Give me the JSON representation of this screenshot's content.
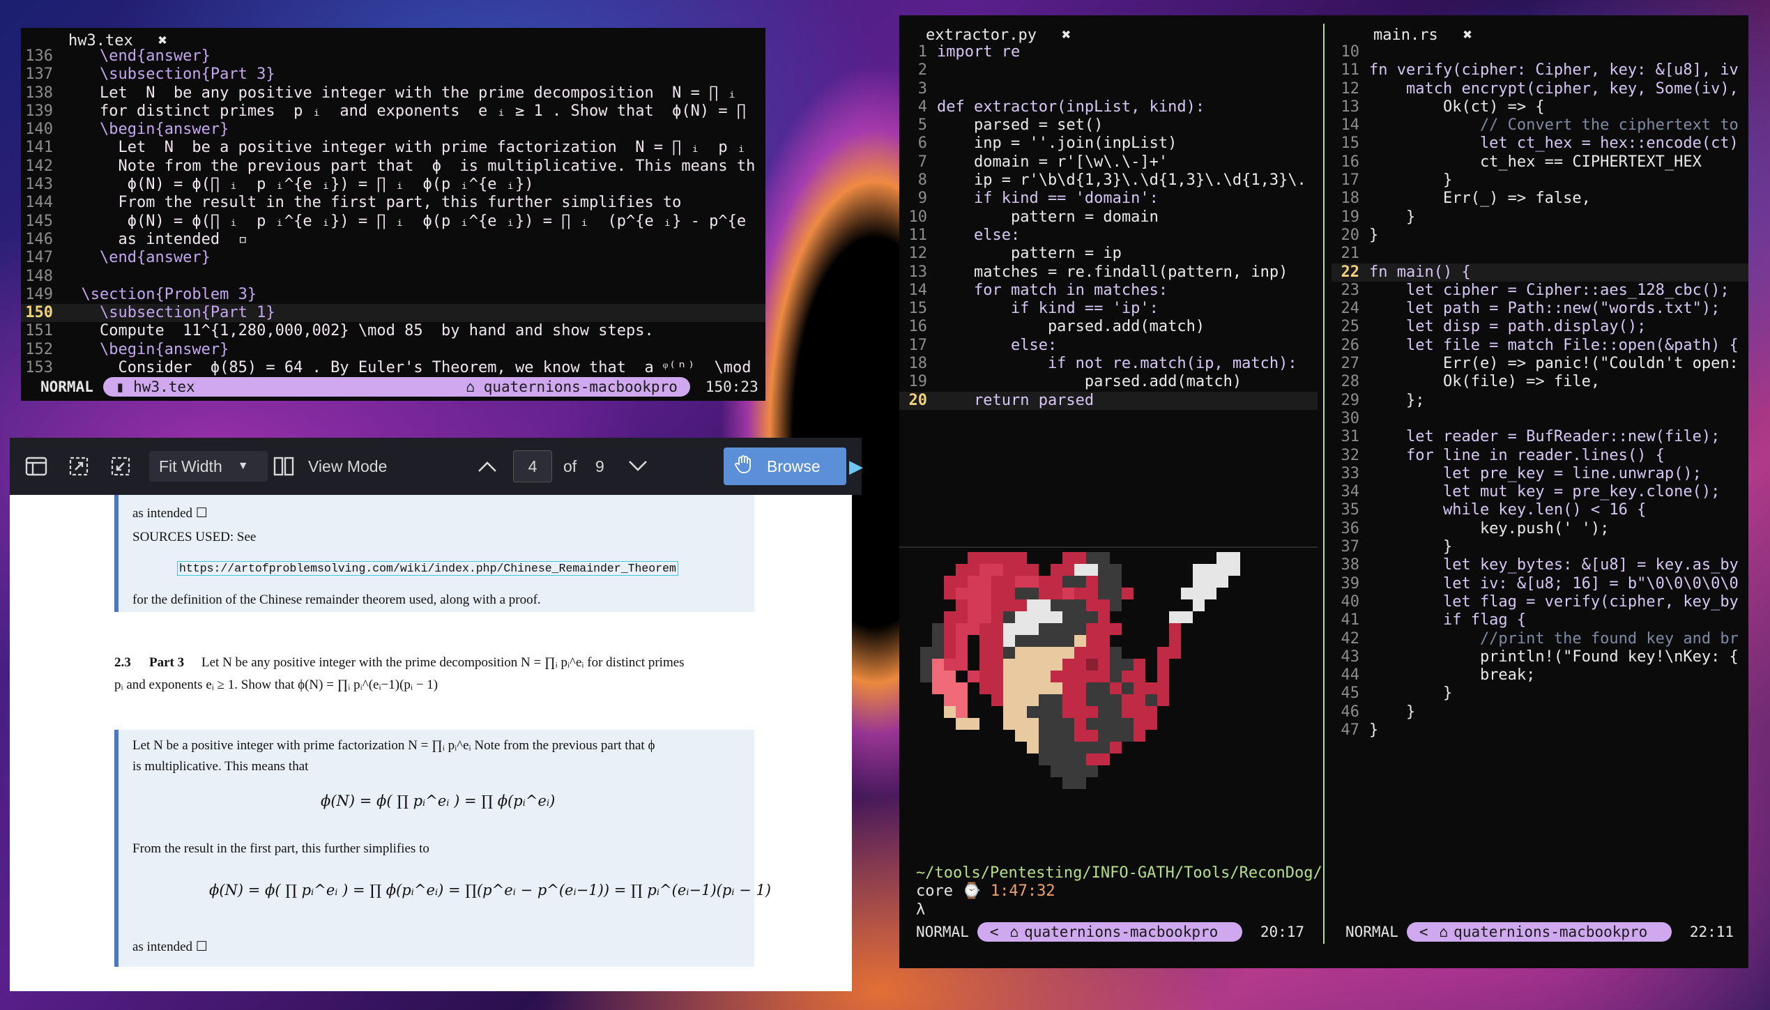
{
  "tex_window": {
    "tab": "hw3.tex",
    "close": "✖",
    "lines": [
      {
        "n": "136",
        "t": "    \\end{answer}"
      },
      {
        "n": "137",
        "t": "    \\subsection{Part 3}"
      },
      {
        "n": "138",
        "t": "    Let  N  be any positive integer with the prime decomposition  N = ∏ ᵢ"
      },
      {
        "n": "139",
        "t": "    for distinct primes  p ᵢ  and exponents  e ᵢ ≥ 1 . Show that  ϕ(N) = ∏"
      },
      {
        "n": "140",
        "t": "    \\begin{answer}"
      },
      {
        "n": "141",
        "t": "      Let  N  be a positive integer with prime factorization  N = ∏ ᵢ  p ᵢ"
      },
      {
        "n": "142",
        "t": "      Note from the previous part that  ϕ  is multiplicative. This means th"
      },
      {
        "n": "143",
        "t": "       ϕ(N) = ϕ(∏ ᵢ  p ᵢ^{e ᵢ}) = ∏ ᵢ  ϕ(p ᵢ^{e ᵢ})"
      },
      {
        "n": "144",
        "t": "      From the result in the first part, this further simplifies to"
      },
      {
        "n": "145",
        "t": "       ϕ(N) = ϕ(∏ ᵢ  p ᵢ^{e ᵢ}) = ∏ ᵢ  ϕ(p ᵢ^{e ᵢ}) = ∏ ᵢ  (p^{e ᵢ} - p^{e"
      },
      {
        "n": "146",
        "t": "      as intended  ▫"
      },
      {
        "n": "147",
        "t": "    \\end{answer}"
      },
      {
        "n": "148",
        "t": ""
      },
      {
        "n": "149",
        "t": "  \\section{Problem 3}"
      },
      {
        "n": "150",
        "t": "    \\subsection{Part 1}"
      },
      {
        "n": "151",
        "t": "    Compute  11^{1,280,000,002} \\mod 85  by hand and show steps."
      },
      {
        "n": "152",
        "t": "    \\begin{answer}"
      },
      {
        "n": "153",
        "t": "      Consider  ϕ(85) = 64 . By Euler's Theorem, we know that  a ᵠ⁽ⁿ⁾  \\mod"
      }
    ],
    "status": {
      "mode": "NORMAL",
      "file": "hw3.tex",
      "host": "quaternions-macbookpro",
      "pos": "150:23"
    }
  },
  "pdf_viewer": {
    "toolbar": {
      "fit": "Fit Width",
      "view_mode": "View Mode",
      "page": "4",
      "of": "of",
      "total": "9",
      "browse": "Browse"
    },
    "content": {
      "intended1": "as intended ☐",
      "sources": "SOURCES USED: See",
      "link": "https://artofproblemsolving.com/wiki/index.php/Chinese_Remainder_Theorem",
      "def": "for the definition of the Chinese remainder theorem used, along with a proof.",
      "sec_num": "2.3",
      "sec_title": "Part 3",
      "q_a": "Let N be any positive integer with the prime decomposition N = ∏ᵢ pᵢ^eᵢ for distinct primes",
      "q_b": "pᵢ and exponents eᵢ ≥ 1. Show that ϕ(N) = ∏ᵢ pᵢ^(eᵢ−1)(pᵢ − 1)",
      "a1": "Let N be a positive integer with prime factorization N = ∏ᵢ pᵢ^eᵢ Note from the previous part that ϕ",
      "a2": "is multiplicative. This means that",
      "eq1": "ϕ(N) = ϕ( ∏ pᵢ^eᵢ ) = ∏ ϕ(pᵢ^eᵢ)",
      "a3": "From the result in the first part, this further simplifies to",
      "eq2": "ϕ(N) = ϕ( ∏ pᵢ^eᵢ ) = ∏ ϕ(pᵢ^eᵢ) = ∏(p^eᵢ − p^(eᵢ−1)) = ∏ pᵢ^(eᵢ−1)(pᵢ − 1)",
      "intended2": "as intended ☐"
    }
  },
  "py_window": {
    "tab": "extractor.py",
    "close": "✖",
    "lines": [
      {
        "n": "1",
        "t": "import re"
      },
      {
        "n": "2",
        "t": ""
      },
      {
        "n": "3",
        "t": ""
      },
      {
        "n": "4",
        "t": "def extractor(inpList, kind):"
      },
      {
        "n": "5",
        "t": "    parsed = set()"
      },
      {
        "n": "6",
        "t": "    inp = ''.join(inpList)"
      },
      {
        "n": "7",
        "t": "    domain = r'[\\w\\.\\-]+'"
      },
      {
        "n": "8",
        "t": "    ip = r'\\b\\d{1,3}\\.\\d{1,3}\\.\\d{1,3}\\."
      },
      {
        "n": "9",
        "t": "    if kind == 'domain':"
      },
      {
        "n": "10",
        "t": "        pattern = domain"
      },
      {
        "n": "11",
        "t": "    else:"
      },
      {
        "n": "12",
        "t": "        pattern = ip"
      },
      {
        "n": "13",
        "t": "    matches = re.findall(pattern, inp)"
      },
      {
        "n": "14",
        "t": "    for match in matches:"
      },
      {
        "n": "15",
        "t": "        if kind == 'ip':"
      },
      {
        "n": "16",
        "t": "            parsed.add(match)"
      },
      {
        "n": "17",
        "t": "        else:"
      },
      {
        "n": "18",
        "t": "            if not re.match(ip, match):"
      },
      {
        "n": "19",
        "t": "                parsed.add(match)"
      },
      {
        "n": "20",
        "t": "    return parsed"
      }
    ],
    "prompt_path": "~/tools/Pentesting/INFO-GATH/Tools/ReconDog/",
    "prompt_branch": "core",
    "prompt_time": "1:47:32",
    "prompt_symbol": "λ",
    "status": {
      "mode": "NORMAL",
      "arrow": "<",
      "host": "quaternions-macbookpro",
      "pos": "20:17"
    }
  },
  "rs_window": {
    "tab": "main.rs",
    "close": "✖",
    "lines": [
      {
        "n": "10",
        "t": ""
      },
      {
        "n": "11",
        "t": "fn verify(cipher: Cipher, key: &[u8], iv"
      },
      {
        "n": "12",
        "t": "    match encrypt(cipher, key, Some(iv),"
      },
      {
        "n": "13",
        "t": "        Ok(ct) => {"
      },
      {
        "n": "14",
        "t": "            // Convert the ciphertext to"
      },
      {
        "n": "15",
        "t": "            let ct_hex = hex::encode(ct)"
      },
      {
        "n": "16",
        "t": "            ct_hex == CIPHERTEXT_HEX"
      },
      {
        "n": "17",
        "t": "        }"
      },
      {
        "n": "18",
        "t": "        Err(_) => false,"
      },
      {
        "n": "19",
        "t": "    }"
      },
      {
        "n": "20",
        "t": "}"
      },
      {
        "n": "21",
        "t": ""
      },
      {
        "n": "22",
        "t": "fn main() {"
      },
      {
        "n": "23",
        "t": "    let cipher = Cipher::aes_128_cbc();"
      },
      {
        "n": "24",
        "t": "    let path = Path::new(\"words.txt\");"
      },
      {
        "n": "25",
        "t": "    let disp = path.display();"
      },
      {
        "n": "26",
        "t": "    let file = match File::open(&path) {"
      },
      {
        "n": "27",
        "t": "        Err(e) => panic!(\"Couldn't open:"
      },
      {
        "n": "28",
        "t": "        Ok(file) => file,"
      },
      {
        "n": "29",
        "t": "    };"
      },
      {
        "n": "30",
        "t": ""
      },
      {
        "n": "31",
        "t": "    let reader = BufReader::new(file);"
      },
      {
        "n": "32",
        "t": "    for line in reader.lines() {"
      },
      {
        "n": "33",
        "t": "        let pre_key = line.unwrap();"
      },
      {
        "n": "34",
        "t": "        let mut key = pre_key.clone();"
      },
      {
        "n": "35",
        "t": "        while key.len() < 16 {"
      },
      {
        "n": "36",
        "t": "            key.push(' ');"
      },
      {
        "n": "37",
        "t": "        }"
      },
      {
        "n": "38",
        "t": "        let key_bytes: &[u8] = key.as_by"
      },
      {
        "n": "39",
        "t": "        let iv: &[u8; 16] = b\"\\0\\0\\0\\0\\0"
      },
      {
        "n": "40",
        "t": "        let flag = verify(cipher, key_by"
      },
      {
        "n": "41",
        "t": "        if flag {"
      },
      {
        "n": "42",
        "t": "            //print the found key and br"
      },
      {
        "n": "43",
        "t": "            println!(\"Found key!\\nKey: {"
      },
      {
        "n": "44",
        "t": "            break;"
      },
      {
        "n": "45",
        "t": "        }"
      },
      {
        "n": "46",
        "t": "    }"
      },
      {
        "n": "47",
        "t": "}"
      }
    ],
    "status": {
      "mode": "NORMAL",
      "arrow": "<",
      "host": "quaternions-macbookpro",
      "pos": "22:11"
    }
  },
  "icons": [
    "sidebar-toggle-icon",
    "fit-page-icon",
    "shrink-icon",
    "dropdown-arrow-icon",
    "view-mode-icon",
    "chevron-up-icon",
    "chevron-down-icon",
    "hand-icon",
    "file-icon",
    "home-icon",
    "clock-icon"
  ],
  "colors": {
    "accent_pill": "#cfa8ef",
    "browse_btn": "#5b8fd8",
    "pdf_box_bg": "#eaf0f8",
    "pdf_box_border": "#4a78c8",
    "terminal_bg": "#0b0b0b"
  }
}
